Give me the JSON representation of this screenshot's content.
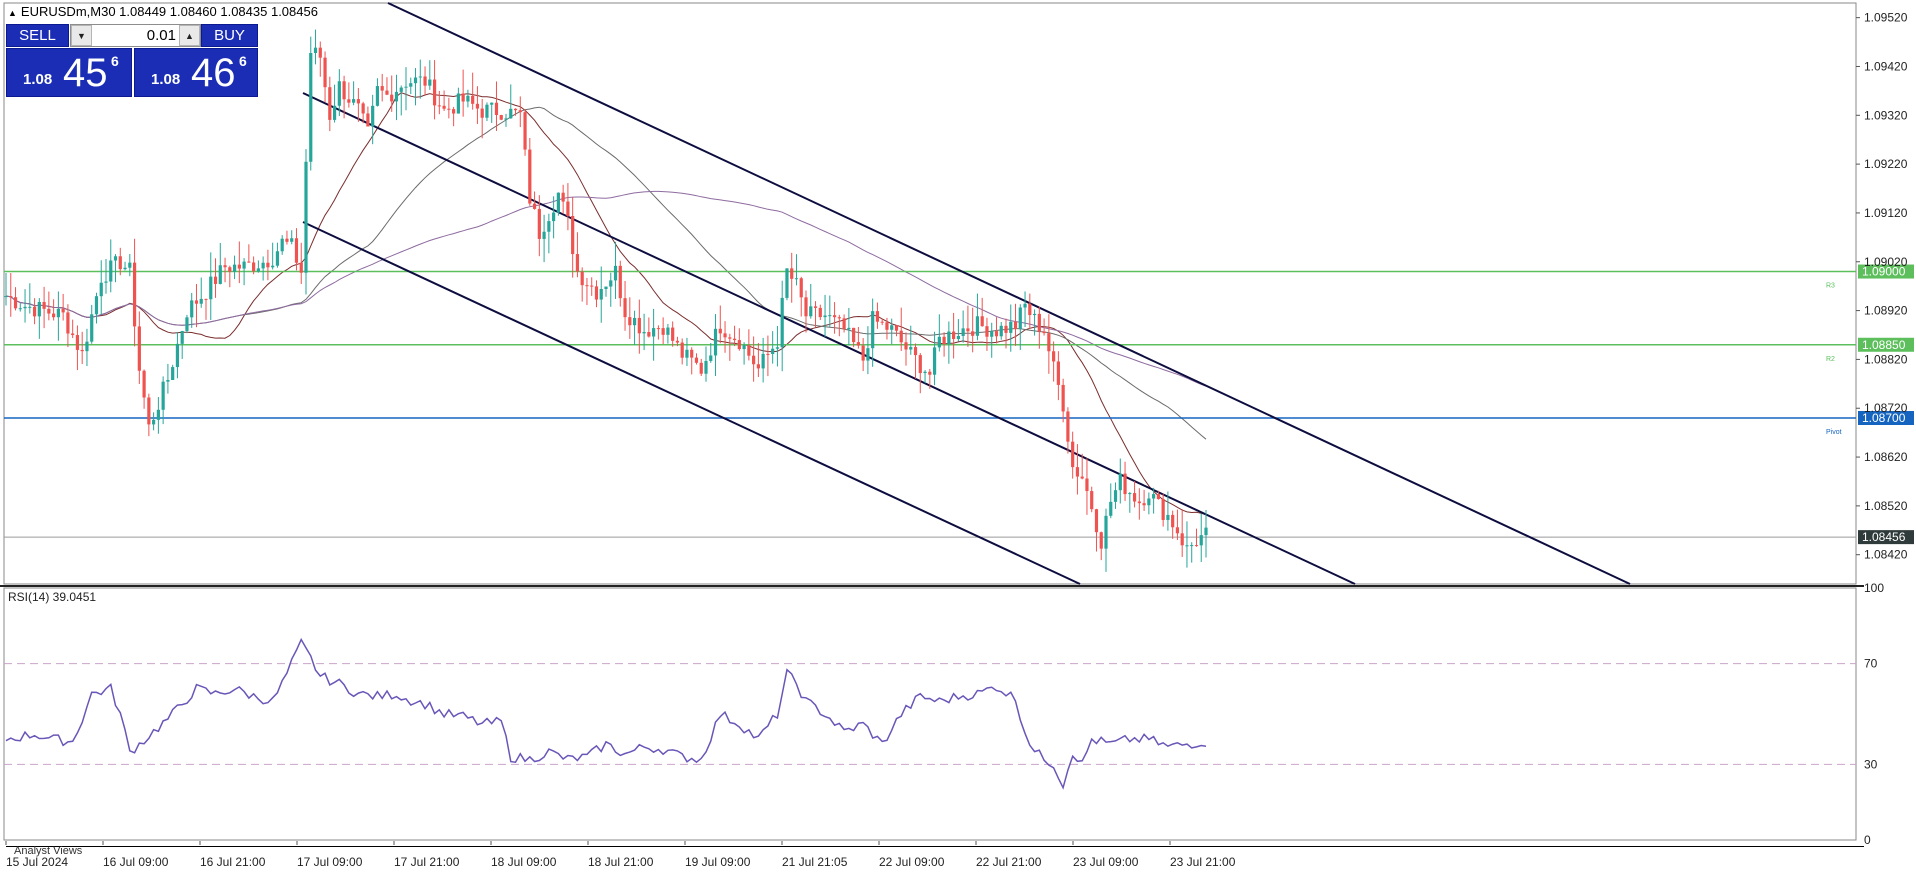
{
  "header": {
    "symbol_line": "EURUSDm,M30  1.08449 1.08460 1.08435 1.08456"
  },
  "trade_panel": {
    "sell_label": "SELL",
    "buy_label": "BUY",
    "lot_value": "0.01",
    "sell_price_small": "1.08",
    "sell_price_big": "45",
    "sell_price_sup": "6",
    "buy_price_small": "1.08",
    "buy_price_big": "46",
    "buy_price_sup": "6"
  },
  "footer": {
    "tab_label": "Analyst Views"
  },
  "colors": {
    "bull": "#26a69a",
    "bear": "#ef5350",
    "channel": "#0d0d3f",
    "sr_line": "#5cbf5c",
    "pivot_line": "#1565c0",
    "rsi_line": "#6a56b8",
    "ma_fast": "#7b2d2d",
    "ma_mid": "#6b6b6b",
    "ma_slow": "#8e6ba0"
  },
  "chart_data": [
    {
      "type": "candlestick",
      "title": "EURUSDm,M30",
      "ylim": [
        1.0836,
        1.0955
      ],
      "y_ticks": [
        "1.09520",
        "1.09420",
        "1.09320",
        "1.09220",
        "1.09120",
        "1.09020",
        "1.08920",
        "1.08820",
        "1.08720",
        "1.08620",
        "1.08520",
        "1.08420"
      ],
      "x_ticks": [
        "15 Jul 2024",
        "16 Jul 09:00",
        "16 Jul 21:00",
        "17 Jul 09:00",
        "17 Jul 21:00",
        "18 Jul 09:00",
        "18 Jul 21:00",
        "19 Jul 09:00",
        "21 Jul 21:05",
        "22 Jul 09:00",
        "22 Jul 21:00",
        "23 Jul 09:00",
        "23 Jul 21:00"
      ],
      "keypoints": [
        [
          0,
          1.0895
        ],
        [
          4,
          1.0893
        ],
        [
          8,
          1.0892
        ],
        [
          12,
          1.0891
        ],
        [
          16,
          1.0883
        ],
        [
          20,
          1.0899
        ],
        [
          24,
          1.0902
        ],
        [
          26,
          1.09
        ],
        [
          28,
          1.088
        ],
        [
          30,
          1.0868
        ],
        [
          34,
          1.0878
        ],
        [
          38,
          1.0892
        ],
        [
          42,
          1.0896
        ],
        [
          46,
          1.0901
        ],
        [
          50,
          1.0901
        ],
        [
          54,
          1.0902
        ],
        [
          56,
          1.0903
        ],
        [
          58,
          1.0906
        ],
        [
          60,
          1.0905
        ],
        [
          62,
          1.09
        ],
        [
          64,
          1.0945
        ],
        [
          66,
          1.0944
        ],
        [
          68,
          1.0932
        ],
        [
          70,
          1.0938
        ],
        [
          74,
          1.0933
        ],
        [
          76,
          1.0928
        ],
        [
          78,
          1.0937
        ],
        [
          80,
          1.0936
        ],
        [
          84,
          1.0939
        ],
        [
          88,
          1.0939
        ],
        [
          92,
          1.0933
        ],
        [
          96,
          1.0935
        ],
        [
          100,
          1.0933
        ],
        [
          104,
          1.0933
        ],
        [
          108,
          1.0932
        ],
        [
          110,
          1.0915
        ],
        [
          112,
          1.0908
        ],
        [
          114,
          1.0912
        ],
        [
          116,
          1.0916
        ],
        [
          118,
          1.091
        ],
        [
          120,
          1.09
        ],
        [
          124,
          1.0896
        ],
        [
          128,
          1.09
        ],
        [
          130,
          1.0892
        ],
        [
          134,
          1.0888
        ],
        [
          138,
          1.0889
        ],
        [
          142,
          1.0883
        ],
        [
          146,
          1.088
        ],
        [
          150,
          1.0889
        ],
        [
          154,
          1.0886
        ],
        [
          158,
          1.088
        ],
        [
          162,
          1.0886
        ],
        [
          164,
          1.09
        ],
        [
          166,
          1.0897
        ],
        [
          168,
          1.0891
        ],
        [
          172,
          1.0891
        ],
        [
          176,
          1.0888
        ],
        [
          180,
          1.0882
        ],
        [
          182,
          1.089
        ],
        [
          186,
          1.0888
        ],
        [
          190,
          1.0883
        ],
        [
          194,
          1.0879
        ],
        [
          196,
          1.0886
        ],
        [
          200,
          1.0888
        ],
        [
          204,
          1.0889
        ],
        [
          208,
          1.0888
        ],
        [
          212,
          1.0889
        ],
        [
          214,
          1.0893
        ],
        [
          216,
          1.089
        ],
        [
          218,
          1.0888
        ],
        [
          220,
          1.088
        ],
        [
          222,
          1.0873
        ],
        [
          224,
          1.086
        ],
        [
          226,
          1.0858
        ],
        [
          228,
          1.0852
        ],
        [
          230,
          1.0845
        ],
        [
          232,
          1.0853
        ],
        [
          234,
          1.0857
        ],
        [
          236,
          1.0855
        ],
        [
          238,
          1.0853
        ],
        [
          240,
          1.0855
        ],
        [
          242,
          1.0852
        ],
        [
          244,
          1.085
        ],
        [
          246,
          1.0847
        ],
        [
          248,
          1.0843
        ],
        [
          250,
          1.0845
        ],
        [
          252,
          1.0846
        ]
      ],
      "last_price": 1.08456,
      "horizontal_levels": [
        {
          "price": 1.09,
          "label": "1.09000",
          "tag": "R3",
          "color": "#5cbf5c"
        },
        {
          "price": 1.0885,
          "label": "1.08850",
          "tag": "R2",
          "color": "#5cbf5c"
        },
        {
          "price": 1.087,
          "label": "1.08700",
          "tag": "Pivot",
          "color": "#1565c0"
        }
      ],
      "last_price_label": "1.08456"
    },
    {
      "type": "line",
      "title": "RSI(14) 39.0451",
      "ylim": [
        0,
        100
      ],
      "y_ticks": [
        "100",
        "70",
        "30",
        "0"
      ],
      "levels": [
        70,
        30
      ],
      "keypoints": [
        [
          0,
          40
        ],
        [
          6,
          42
        ],
        [
          10,
          40
        ],
        [
          14,
          39
        ],
        [
          16,
          48
        ],
        [
          18,
          58
        ],
        [
          22,
          60
        ],
        [
          24,
          50
        ],
        [
          26,
          35
        ],
        [
          28,
          38
        ],
        [
          34,
          48
        ],
        [
          40,
          60
        ],
        [
          44,
          58
        ],
        [
          48,
          60
        ],
        [
          52,
          57
        ],
        [
          56,
          55
        ],
        [
          58,
          62
        ],
        [
          60,
          70
        ],
        [
          62,
          78
        ],
        [
          64,
          72
        ],
        [
          66,
          65
        ],
        [
          70,
          62
        ],
        [
          74,
          58
        ],
        [
          78,
          57
        ],
        [
          82,
          58
        ],
        [
          84,
          56
        ],
        [
          88,
          54
        ],
        [
          92,
          50
        ],
        [
          96,
          49
        ],
        [
          100,
          46
        ],
        [
          104,
          47
        ],
        [
          106,
          33
        ],
        [
          110,
          32
        ],
        [
          114,
          35
        ],
        [
          118,
          32
        ],
        [
          122,
          33
        ],
        [
          126,
          38
        ],
        [
          130,
          34
        ],
        [
          134,
          37
        ],
        [
          138,
          36
        ],
        [
          142,
          33
        ],
        [
          146,
          32
        ],
        [
          150,
          50
        ],
        [
          154,
          46
        ],
        [
          158,
          40
        ],
        [
          162,
          50
        ],
        [
          164,
          66
        ],
        [
          166,
          62
        ],
        [
          168,
          55
        ],
        [
          172,
          50
        ],
        [
          176,
          43
        ],
        [
          180,
          46
        ],
        [
          184,
          38
        ],
        [
          188,
          50
        ],
        [
          192,
          57
        ],
        [
          196,
          55
        ],
        [
          200,
          57
        ],
        [
          204,
          58
        ],
        [
          208,
          61
        ],
        [
          212,
          56
        ],
        [
          214,
          43
        ],
        [
          216,
          35
        ],
        [
          220,
          30
        ],
        [
          222,
          22
        ],
        [
          224,
          35
        ],
        [
          226,
          30
        ],
        [
          228,
          40
        ],
        [
          232,
          38
        ],
        [
          236,
          40
        ],
        [
          240,
          40
        ],
        [
          244,
          37
        ],
        [
          248,
          38
        ],
        [
          252,
          39
        ]
      ]
    }
  ]
}
